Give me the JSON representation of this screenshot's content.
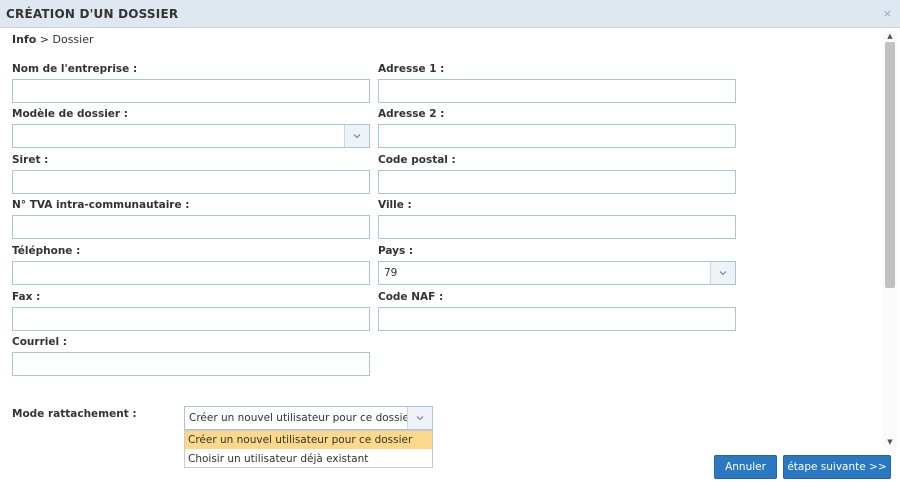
{
  "dialog": {
    "title": "CRÉATION D'UN DOSSIER",
    "close_symbol": "×"
  },
  "breadcrumb": {
    "current": "Info",
    "separator": ">",
    "next": "Dossier"
  },
  "form": {
    "left": {
      "nom_entreprise": {
        "label": "Nom de l'entreprise :",
        "value": ""
      },
      "modele_dossier": {
        "label": "Modèle de dossier :",
        "value": ""
      },
      "siret": {
        "label": "Siret :",
        "value": ""
      },
      "tva": {
        "label": "N° TVA intra-communautaire :",
        "value": ""
      },
      "telephone": {
        "label": "Téléphone :",
        "value": ""
      },
      "fax": {
        "label": "Fax :",
        "value": ""
      },
      "courriel": {
        "label": "Courriel :",
        "value": ""
      }
    },
    "right": {
      "adresse1": {
        "label": "Adresse 1 :",
        "value": ""
      },
      "adresse2": {
        "label": "Adresse 2 :",
        "value": ""
      },
      "code_postal": {
        "label": "Code postal :",
        "value": ""
      },
      "ville": {
        "label": "Ville :",
        "value": ""
      },
      "pays": {
        "label": "Pays :",
        "value": "79"
      },
      "code_naf": {
        "label": "Code NAF :",
        "value": ""
      }
    },
    "mode_rattachement": {
      "label": "Mode rattachement :",
      "value": "Créer un nouvel utilisateur pour ce dossier",
      "options": [
        "Créer un nouvel utilisateur pour ce dossier",
        "Choisir un utilisateur déjà existant"
      ]
    }
  },
  "buttons": {
    "cancel": "Annuler",
    "next": "étape suivante >>"
  },
  "icons": {
    "close": "close-icon",
    "dropdown": "chevron-down-icon",
    "scroll_up": "scroll-up-arrow-icon",
    "scroll_down": "scroll-down-arrow-icon"
  },
  "colors": {
    "titlebar_bg": "#dfe8f1",
    "input_border": "#a9c4de",
    "button_bg": "#2b78c2",
    "selected_option_bg": "#fbd88a"
  }
}
